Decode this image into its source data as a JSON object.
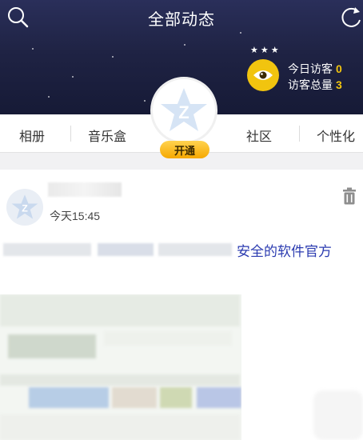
{
  "header": {
    "title": "全部动态",
    "icons": {
      "left": "search-icon",
      "right": "refresh-icon"
    }
  },
  "visitors": {
    "today_label": "今日访客",
    "today_count": "0",
    "total_label": "访客总量",
    "total_count": "3",
    "badge_icon": "eye-icon"
  },
  "tabs": [
    "相册",
    "音乐盒",
    "社区",
    "个性化"
  ],
  "profile": {
    "open_badge": "开通",
    "avatar_icon": "qzone-star-icon"
  },
  "post": {
    "time": "今天15:45",
    "text_visible": "安全的软件官方",
    "delete_icon": "trash-icon"
  },
  "colors": {
    "cover_bg": "#1f2344",
    "accent_yellow": "#f1c40f",
    "link_blue": "#2b3bb0",
    "green": "#3bb24a"
  }
}
